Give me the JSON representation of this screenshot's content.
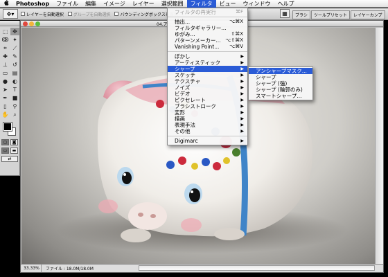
{
  "menubar": {
    "apple": "",
    "items": [
      {
        "label": "Photoshop",
        "app": true
      },
      {
        "label": "ファイル"
      },
      {
        "label": "編集"
      },
      {
        "label": "イメージ"
      },
      {
        "label": "レイヤー"
      },
      {
        "label": "選択範囲"
      },
      {
        "label": "フィルタ",
        "active": true
      },
      {
        "label": "ビュー"
      },
      {
        "label": "ウィンドウ"
      },
      {
        "label": "ヘルプ"
      }
    ]
  },
  "options_bar": {
    "tool_preset_icon": "move-tool-icon",
    "auto_select_layer": "レイヤーを自動選択",
    "auto_select_group": "グループを自動選択",
    "show_bounding_box": "バウンディングボックスを表示",
    "palette_wells": [
      "ブラシ",
      "ツールプリセット",
      "レイヤーカンプ"
    ]
  },
  "document": {
    "title": "04.アニ",
    "zoom": "33.33%",
    "file_info": "ファイル : 18.0M/18.0M"
  },
  "filter_menu": {
    "items": [
      {
        "label": "フィルタの再実行",
        "shortcut": "⌘F",
        "disabled": true
      },
      {
        "sep": true
      },
      {
        "label": "抽出...",
        "shortcut": "⌥⌘X"
      },
      {
        "label": "フィルタギャラリー..."
      },
      {
        "label": "ゆがみ...",
        "shortcut": "⇧⌘X"
      },
      {
        "label": "パターンメーカー...",
        "shortcut": "⌥⇧⌘X"
      },
      {
        "label": "Vanishing Point...",
        "shortcut": "⌥⌘V"
      },
      {
        "sep": true
      },
      {
        "label": "ぼかし",
        "sub": true
      },
      {
        "label": "アーティスティック",
        "sub": true
      },
      {
        "label": "シャープ",
        "sub": true,
        "highlight": true
      },
      {
        "label": "スケッチ",
        "sub": true
      },
      {
        "label": "テクスチャ",
        "sub": true
      },
      {
        "label": "ノイズ",
        "sub": true
      },
      {
        "label": "ビデオ",
        "sub": true
      },
      {
        "label": "ピクセレート",
        "sub": true
      },
      {
        "label": "ブラシストローク",
        "sub": true
      },
      {
        "label": "変形",
        "sub": true
      },
      {
        "label": "描画",
        "sub": true
      },
      {
        "label": "表現手法",
        "sub": true
      },
      {
        "label": "その他",
        "sub": true
      },
      {
        "sep": true
      },
      {
        "label": "Digimarc",
        "sub": true
      }
    ]
  },
  "sharpen_submenu": {
    "items": [
      {
        "label": "アンシャープマスク...",
        "highlight": true
      },
      {
        "label": "シャープ"
      },
      {
        "label": "シャープ (強)"
      },
      {
        "label": "シャープ (輪郭のみ)"
      },
      {
        "label": "スマートシャープ..."
      }
    ]
  },
  "colors": {
    "menu_highlight": "#2a5bd6",
    "foreground": "#000000",
    "background": "#ffffff"
  }
}
